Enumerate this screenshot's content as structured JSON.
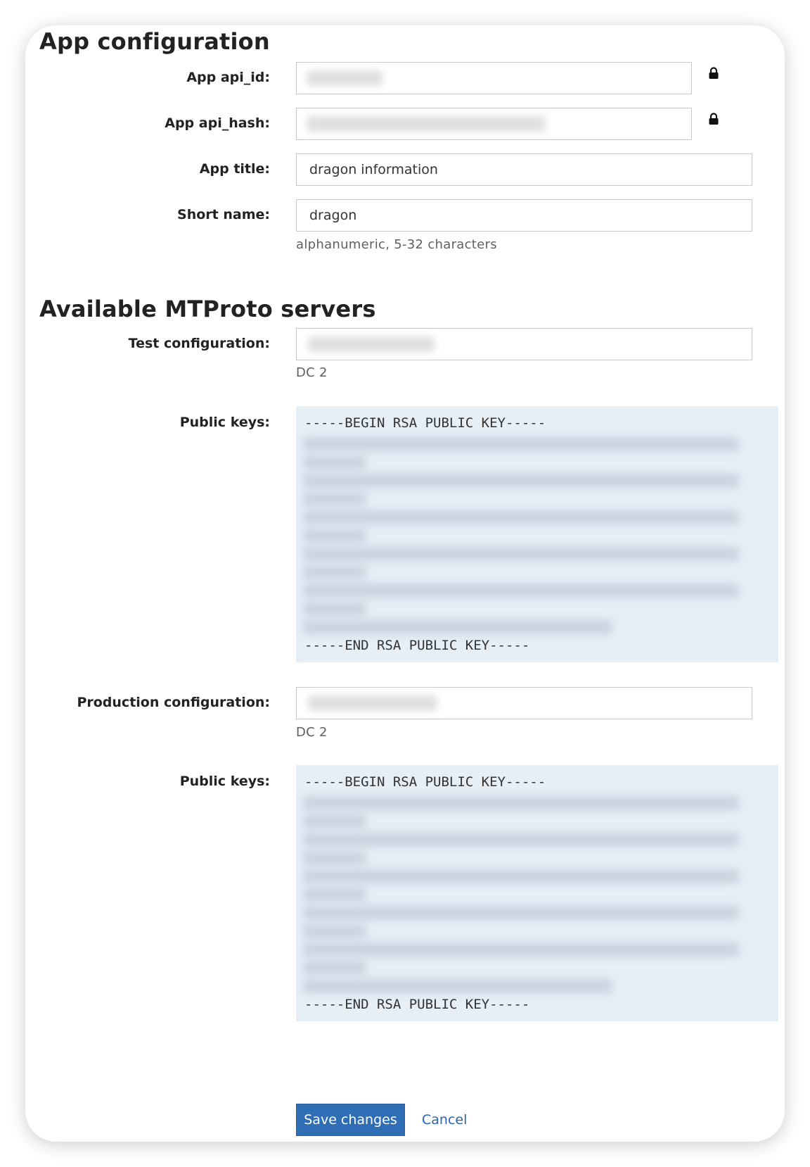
{
  "app_config": {
    "heading": "App configuration",
    "api_id": {
      "label": "App api_id:",
      "value": ""
    },
    "api_hash": {
      "label": "App api_hash:",
      "value": ""
    },
    "title": {
      "label": "App title:",
      "value": "dragon information"
    },
    "short_name": {
      "label": "Short name:",
      "value": "dragon",
      "hint": "alphanumeric, 5-32 characters"
    },
    "lock_icon": "lock-icon"
  },
  "servers": {
    "heading": "Available MTProto servers",
    "test": {
      "label": "Test configuration:",
      "value": "",
      "dc": "DC 2",
      "keys_label": "Public keys:",
      "key_begin": "-----BEGIN RSA PUBLIC KEY-----",
      "key_end": "-----END RSA PUBLIC KEY-----"
    },
    "production": {
      "label": "Production configuration:",
      "value": "",
      "dc": "DC 2",
      "keys_label": "Public keys:",
      "key_begin": "-----BEGIN RSA PUBLIC KEY-----",
      "key_end": "-----END RSA PUBLIC KEY-----"
    }
  },
  "actions": {
    "save_label": "Save changes",
    "cancel_label": "Cancel"
  },
  "colors": {
    "primary_button": "#2f6db5",
    "link": "#2a64b0",
    "key_background": "#e6eef6"
  }
}
